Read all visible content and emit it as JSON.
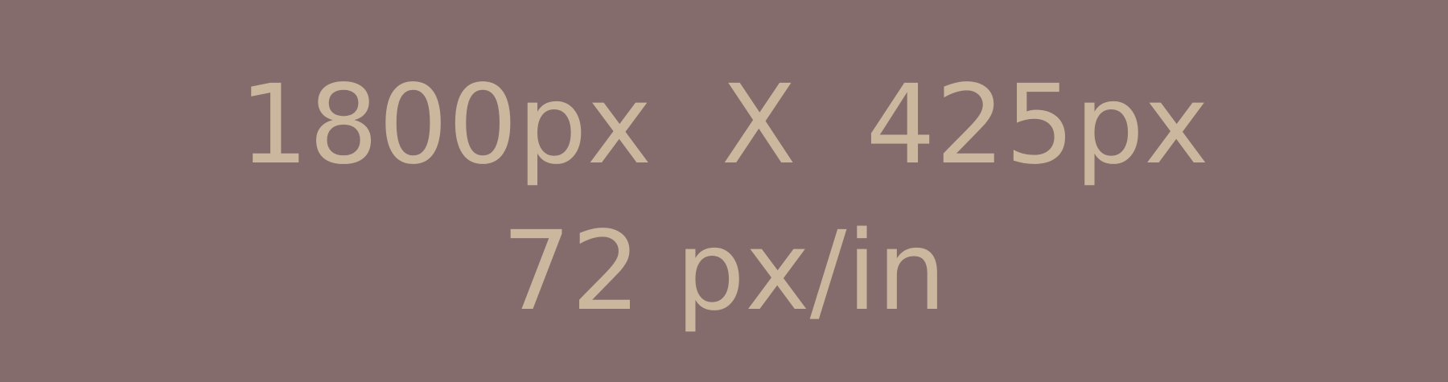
{
  "placeholder": {
    "dimensions_text": "1800px  X  425px",
    "resolution_text": "72 px/in",
    "background_color": "#846c6c",
    "text_color": "#cbb79d"
  }
}
